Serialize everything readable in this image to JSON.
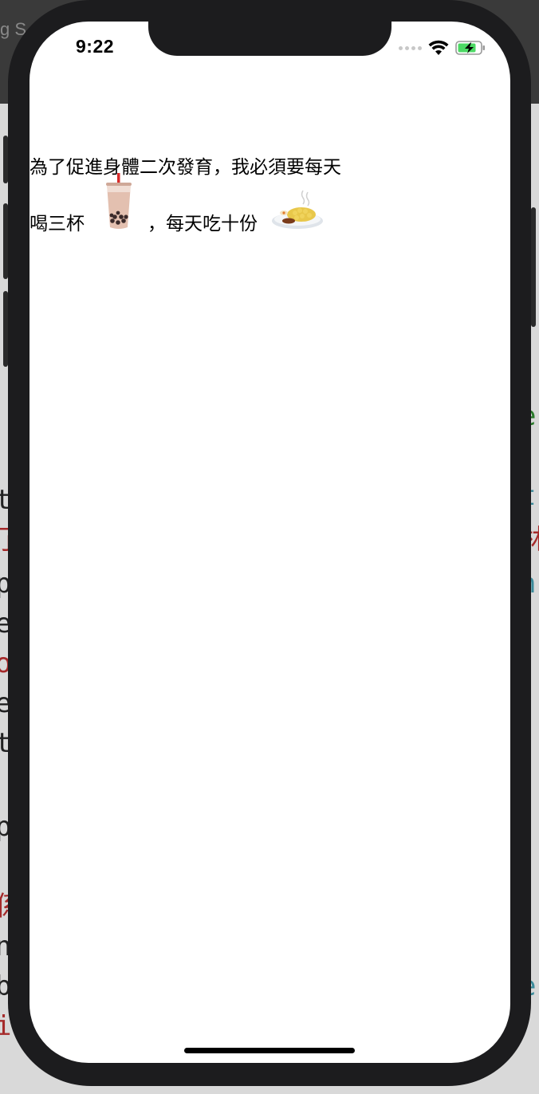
{
  "status_bar": {
    "time": "9:22"
  },
  "content": {
    "line1": "為了促進身體二次發育，我必須要每天",
    "line2_part1": "喝三杯",
    "line2_part2": "，每天吃十份",
    "emoji1": "bubble-tea-icon",
    "emoji2": "curry-rice-icon"
  },
  "colors": {
    "phone_frame": "#1c1c1e",
    "screen": "#ffffff",
    "battery_green": "#4cd964",
    "text": "#000000"
  }
}
